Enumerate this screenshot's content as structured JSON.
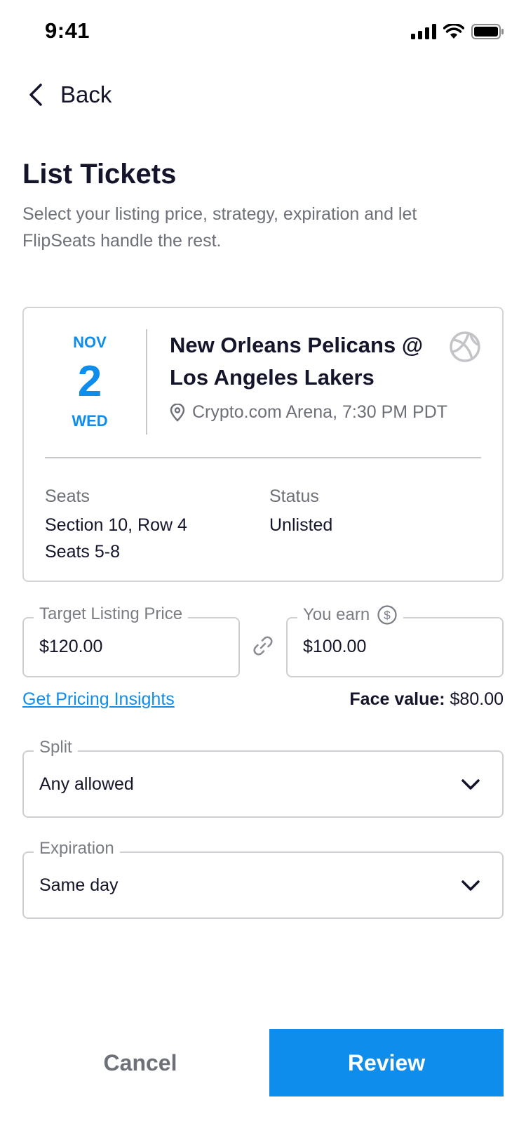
{
  "status_bar": {
    "time": "9:41",
    "icons": [
      "signal-icon",
      "wifi-icon",
      "battery-icon"
    ]
  },
  "header": {
    "back_label": "Back",
    "title": "List Tickets",
    "subtitle": "Select your listing price, strategy, expiration and let FlipSeats handle the rest."
  },
  "event": {
    "month": "NOV",
    "day": "2",
    "weekday": "WED",
    "title": "New Orleans Pelicans @ Los Angeles Lakers",
    "venue": "Crypto.com Arena, 7:30 PM PDT",
    "seats_label": "Seats",
    "seats_line1": "Section 10, Row 4",
    "seats_line2": "Seats 5-8",
    "status_label": "Status",
    "status_value": "Unlisted",
    "sport_icon": "basketball-icon"
  },
  "pricing": {
    "target_label": "Target Listing Price",
    "target_value": "$120.00",
    "earn_label": "You earn",
    "earn_value": "$100.00",
    "insights_link": "Get Pricing Insights",
    "face_label": "Face value:",
    "face_value": "$80.00"
  },
  "split": {
    "label": "Split",
    "value": "Any allowed"
  },
  "expiration": {
    "label": "Expiration",
    "value": "Same day"
  },
  "actions": {
    "cancel": "Cancel",
    "review": "Review"
  },
  "colors": {
    "accent": "#0f8ded",
    "text": "#14142b",
    "muted": "#6e7079",
    "border": "#cfcfd3"
  }
}
